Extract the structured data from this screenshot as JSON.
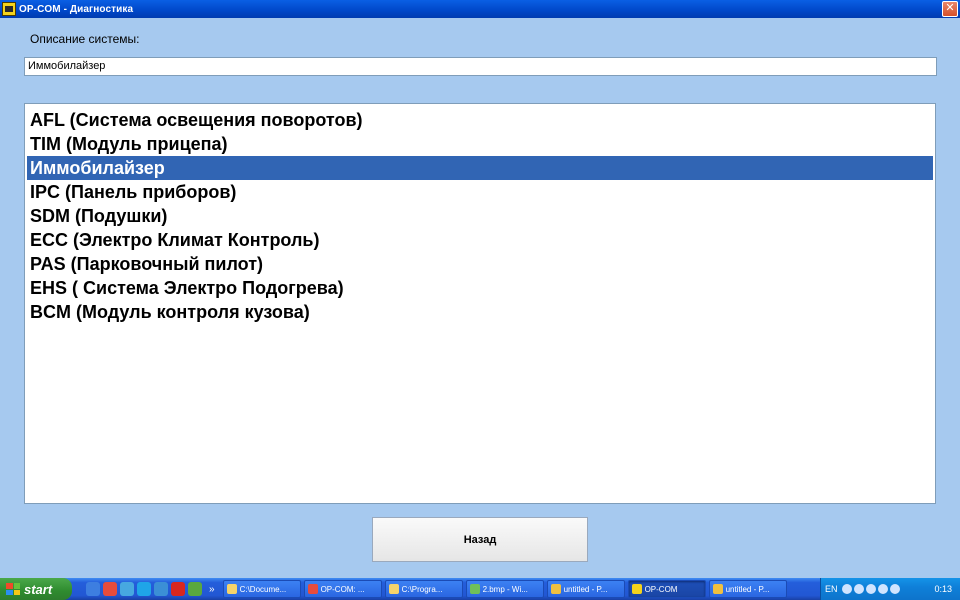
{
  "window": {
    "title": "OP-COM - Диагностика",
    "close_glyph": "✕"
  },
  "description": {
    "label": "Описание системы:",
    "value": "Иммобилайзер"
  },
  "systems": {
    "items": [
      {
        "label": "AFL (Система освещения поворотов)",
        "selected": false
      },
      {
        "label": "TIM (Модуль прицепа)",
        "selected": false
      },
      {
        "label": "Иммобилайзер",
        "selected": true
      },
      {
        "label": "IPC (Панель приборов)",
        "selected": false
      },
      {
        "label": "SDM (Подушки)",
        "selected": false
      },
      {
        "label": "ECC (Электро Климат Контроль)",
        "selected": false
      },
      {
        "label": "PAS (Парковочный пилот)",
        "selected": false
      },
      {
        "label": "EHS ( Система Электро Подогрева)",
        "selected": false
      },
      {
        "label": "BCM (Модуль контроля кузова)",
        "selected": false
      }
    ]
  },
  "back_button": {
    "label": "Назад"
  },
  "taskbar": {
    "start_label": "start",
    "quick_launch_more": "»",
    "tasks": [
      {
        "label": "C:\\Docume...",
        "icon": "folder-icon",
        "color": "#f5d36b"
      },
      {
        "label": "OP-COM: ...",
        "icon": "chrome-icon",
        "color": "#e74c3c"
      },
      {
        "label": "C:\\Progra...",
        "icon": "folder-icon",
        "color": "#f5d36b"
      },
      {
        "label": "2.bmp - Wi...",
        "icon": "image-icon",
        "color": "#6fbf5a"
      },
      {
        "label": "untitled - P...",
        "icon": "paint-icon",
        "color": "#f0c040"
      },
      {
        "label": "OP-COM",
        "icon": "opcom-icon",
        "color": "#f4d21c",
        "active": true
      },
      {
        "label": "untitled - P...",
        "icon": "paint-icon",
        "color": "#f0c040"
      }
    ],
    "tray": {
      "language": "EN",
      "clock": "0:13"
    }
  }
}
